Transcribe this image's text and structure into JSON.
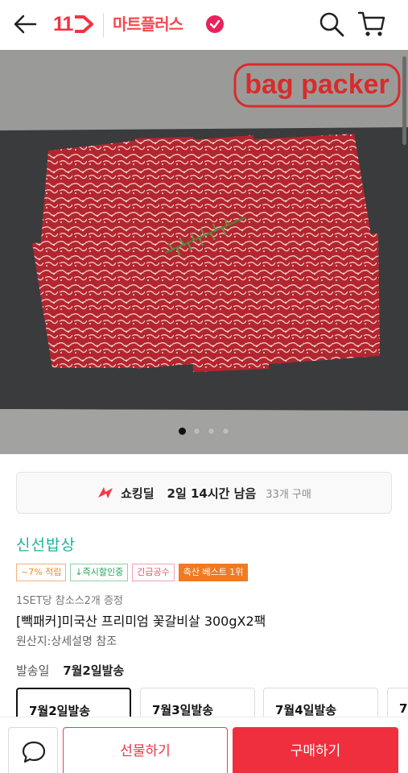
{
  "header": {
    "logo": "11",
    "brand": "마트플러스"
  },
  "hero": {
    "watermark": "bag packer",
    "carousel_total": 4,
    "carousel_active": 1
  },
  "deal": {
    "label": "쇼킹딜",
    "time_left": "2일 14시간 남음",
    "sold": "33개 구매"
  },
  "product": {
    "seller": "신선밥상",
    "tags": [
      {
        "text": "~7% 적립"
      },
      {
        "text": "↓즉시할인중"
      },
      {
        "text": "긴급공수"
      },
      {
        "text": "축산 베스트 1위"
      }
    ],
    "promo": "1SET당 참소스2개 증정",
    "title": "[빽패커]미국산 프리미엄 꽃갈비살 300gX2팩",
    "origin": "원산지:상세설명 참조"
  },
  "shipping": {
    "label": "발송일",
    "value": "7월2일발송",
    "options": [
      "7월2일발송",
      "7월3일발송",
      "7월4일발송",
      "7"
    ]
  },
  "actions": {
    "gift": "선물하기",
    "buy": "구매하기"
  },
  "colors": {
    "brand_red": "#f43142",
    "seller_green": "#1bb39a",
    "buy_red": "#ef2f3d"
  }
}
